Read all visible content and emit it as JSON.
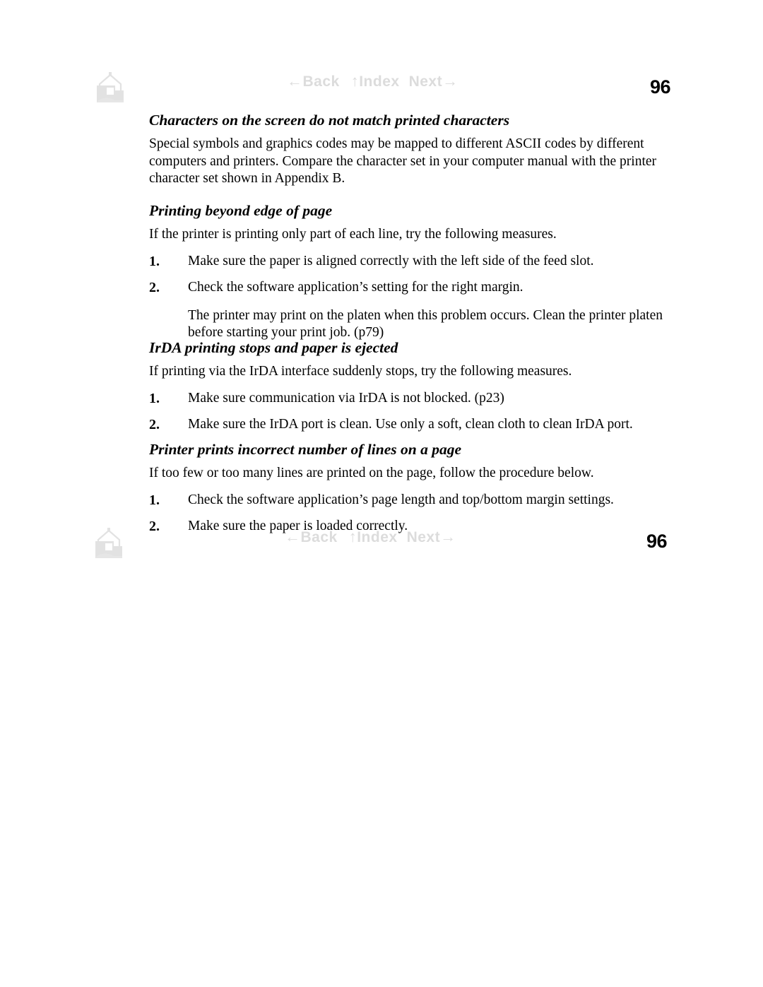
{
  "document": {
    "page_number": "96",
    "nav": {
      "home_icon": "home-icon",
      "back_arrow": "←",
      "back_label": "Back",
      "index_arrow": "↑",
      "index_label": "Index",
      "next_label": "Next",
      "next_arrow": "→"
    },
    "colors": {
      "nav_link": "#dcdcdc",
      "text": "#000000",
      "background": "#ffffff"
    }
  },
  "sections": [
    {
      "heading": "Characters on the screen do not match printed characters",
      "intro": "Special symbols and graphics codes may be mapped to different ASCII codes by different computers and printers. Compare the character set in your computer manual with the printer character set shown in Appendix B.",
      "items": [],
      "note": ""
    },
    {
      "heading": "Printing beyond edge of page",
      "intro": "If the printer is printing only part of each line, try the following measures.",
      "items": [
        {
          "num": "1.",
          "text": "Make sure the paper is aligned correctly with the left side of the feed slot."
        },
        {
          "num": "2.",
          "text": "Check the software application’s setting for the right margin."
        }
      ],
      "note": "The printer may print on the platen when this problem occurs. Clean the printer platen before starting your print job. (p79)"
    },
    {
      "heading": "IrDA printing stops and paper is ejected",
      "intro": "If printing via the IrDA interface suddenly stops, try the following measures.",
      "items": [
        {
          "num": "1.",
          "text": "Make sure communication via IrDA is not blocked. (p23)"
        },
        {
          "num": "2.",
          "text": "Make sure the IrDA port is clean. Use only a soft, clean cloth to clean IrDA port."
        }
      ],
      "note": ""
    },
    {
      "heading": "Printer prints incorrect number of lines on a page",
      "intro": "If too few or too many lines are printed on the page, follow the procedure below.",
      "items": [
        {
          "num": "1.",
          "text": "Check the software application’s page length and top/bottom margin settings."
        },
        {
          "num": "2.",
          "text": "Make sure the paper is loaded correctly."
        }
      ],
      "note": ""
    }
  ]
}
